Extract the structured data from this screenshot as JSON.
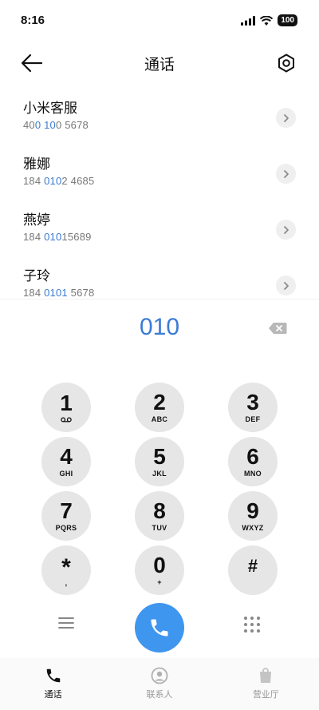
{
  "status_bar": {
    "time": "8:16",
    "battery": "100"
  },
  "header": {
    "title": "通话"
  },
  "contacts": [
    {
      "name": "小米客服",
      "number_parts": [
        "40",
        "0 10",
        "0 5678"
      ]
    },
    {
      "name": "雅娜",
      "number_parts": [
        "184 ",
        "010",
        "2 4685"
      ]
    },
    {
      "name": "燕婷",
      "number_parts": [
        "184 ",
        "010",
        "15689"
      ]
    },
    {
      "name": "子玲",
      "number_parts": [
        "184 ",
        "0101",
        " 5678"
      ]
    }
  ],
  "dialer": {
    "input": "010",
    "keys": [
      {
        "digit": "1",
        "letters": ""
      },
      {
        "digit": "2",
        "letters": "ABC"
      },
      {
        "digit": "3",
        "letters": "DEF"
      },
      {
        "digit": "4",
        "letters": "GHI"
      },
      {
        "digit": "5",
        "letters": "JKL"
      },
      {
        "digit": "6",
        "letters": "MNO"
      },
      {
        "digit": "7",
        "letters": "PQRS"
      },
      {
        "digit": "8",
        "letters": "TUV"
      },
      {
        "digit": "9",
        "letters": "WXYZ"
      },
      {
        "digit": "*",
        "letters": ","
      },
      {
        "digit": "0",
        "letters": "+"
      },
      {
        "digit": "#",
        "letters": ""
      }
    ]
  },
  "bottom_nav": [
    {
      "label": "通话",
      "icon": "phone-icon",
      "active": true
    },
    {
      "label": "联系人",
      "icon": "contact-icon",
      "active": false
    },
    {
      "label": "营业厅",
      "icon": "bag-icon",
      "active": false
    }
  ],
  "colors": {
    "accent": "#3a7bd5",
    "call_button": "#3f96ef",
    "key_bg": "#e6e6e6"
  }
}
